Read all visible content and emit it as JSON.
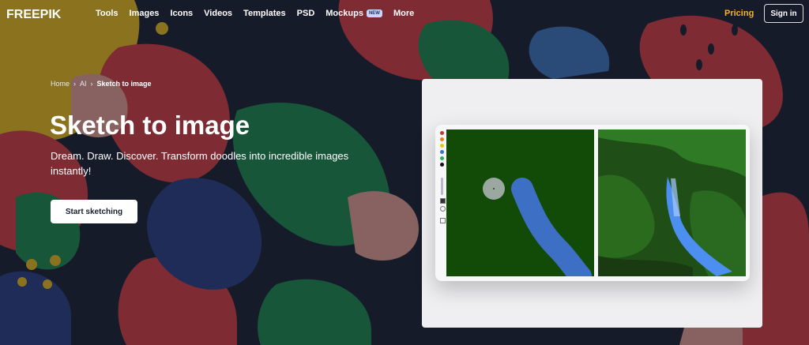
{
  "nav": {
    "logo": "FREEPIK",
    "items": [
      {
        "label": "Tools"
      },
      {
        "label": "Images"
      },
      {
        "label": "Icons"
      },
      {
        "label": "Videos"
      },
      {
        "label": "Templates"
      },
      {
        "label": "PSD"
      },
      {
        "label": "Mockups",
        "badge": "NEW"
      },
      {
        "label": "More"
      }
    ],
    "pricing": "Pricing",
    "signin": "Sign in"
  },
  "breadcrumb": {
    "items": [
      "Home",
      "AI",
      "Sketch to image"
    ]
  },
  "hero": {
    "title": "Sketch to image",
    "subtitle": "Dream. Draw. Discover. Transform doodles into incredible images instantly!",
    "cta": "Start sketching"
  },
  "colors": {
    "pricing": "#f4b42b",
    "cta_bg": "#ffffff",
    "canvas_green": "#124a08",
    "brush_blue": "#3d6fc4"
  },
  "demo": {
    "palette_colors": [
      "#c0392b",
      "#e67e22",
      "#f1c40f",
      "#3b6fd0",
      "#27ae60",
      "#111111"
    ]
  }
}
